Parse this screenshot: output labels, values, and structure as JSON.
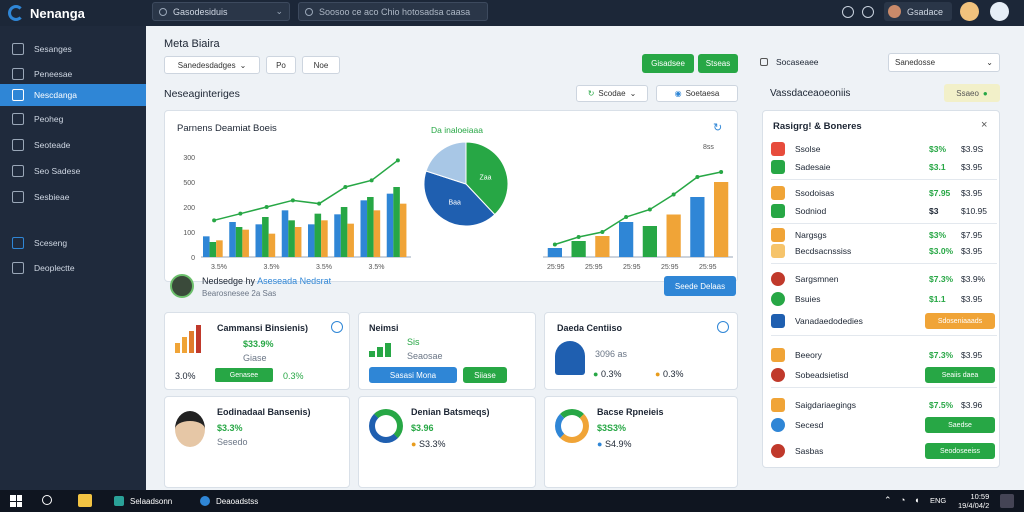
{
  "app": {
    "title": "Nenanga"
  },
  "topbar": {
    "dropdown_label": "Gasodesiduis",
    "search_placeholder": "Soosoo ce aco Chio hotosadsa caasa",
    "user_name": "Gsadace"
  },
  "sidebar": {
    "items": [
      {
        "label": "Sesanges",
        "icon": "grid-icon"
      },
      {
        "label": "Peneesae",
        "icon": "link-icon"
      },
      {
        "label": "Nescdanga",
        "icon": "chart-icon",
        "active": true
      },
      {
        "label": "Peoheg",
        "icon": "pen-icon"
      },
      {
        "label": "Seoteade",
        "icon": "bell-icon"
      },
      {
        "label": "Seo Sadese",
        "icon": "activity-icon"
      },
      {
        "label": "Sesbieae",
        "icon": "cloud-icon"
      },
      {
        "label": "Sceseng",
        "icon": "layers-icon"
      },
      {
        "label": "Deoplectte",
        "icon": "doc-icon"
      }
    ]
  },
  "main": {
    "title": "Meta Biaira",
    "filter_select": "Sanedesdadges",
    "filter_btn1": "Po",
    "filter_btn2": "Noe",
    "action_btn1": "Gisadsee",
    "action_btn2": "Stseas",
    "section_title": "Neseaginteriges",
    "section_select1": "Scodae",
    "section_select2": "Soetaesa",
    "chart": {
      "title": "Parnens Deamiat Boeis",
      "pie_title": "Da inaloeiaaa",
      "pie_labels": [
        "Zaa",
        "Baa"
      ],
      "top_label": "8ss"
    },
    "strip": {
      "title": "Nedsedge hy",
      "highlight": "Aseseada Nedsrat",
      "subtitle": "Bearosnesee 2a Sas",
      "button": "Seede Delaas"
    },
    "cards": [
      {
        "title": "Cammansi Binsienis)",
        "value": "$33.9%",
        "sub": "Giase",
        "f1": "3.0%",
        "f2": "Genasee",
        "f3": "0.3%"
      },
      {
        "title": "Neimsi",
        "value": "Sis",
        "sub": "Seaosae",
        "btn1": "Sasasi Mona",
        "btn2": "Siiase"
      },
      {
        "title": "Daeda Centiiso",
        "sub": "3096 as",
        "f1": "0.3%",
        "f2": "0.3%"
      },
      {
        "title": "Eodinadaal Bansenis)",
        "value": "$3.3%",
        "sub": "Sesedo"
      },
      {
        "title": "Denian Batsmeqs)",
        "value": "$3.96",
        "sub": "S3.3%"
      },
      {
        "title": "Bacse Rpneieis",
        "value": "$3S3%",
        "sub": "S4.9%"
      }
    ]
  },
  "right": {
    "title": "Socaseaee",
    "dropdown": "Sanedosse",
    "section_title": "Vassdaceaoeoniis",
    "badge": "Ssaeo",
    "panel_title": "Rasigrg! & Boneres",
    "rows": [
      {
        "label": "Ssolse",
        "v1": "$3%",
        "v2": "$3.9S"
      },
      {
        "label": "Sadesaie",
        "v1": "$3.1",
        "v2": "$3.95"
      },
      {
        "label": "Ssodoisas",
        "v1": "$7.95",
        "v2": "$3.95"
      },
      {
        "label": "Sodniod",
        "v1": "$3",
        "v2": "$10.95"
      },
      {
        "label": "Nargsgs",
        "v1": "$3%",
        "v2": "$7.95"
      },
      {
        "label": "Becdsacnssiss",
        "v1": "$3.0%",
        "v2": "$3.95"
      },
      {
        "label": "Sargsmnen",
        "v1": "$7.3%",
        "v2": "$3.9%"
      },
      {
        "label": "Bsuies",
        "v1": "$1.1",
        "v2": "$3.95"
      },
      {
        "label": "Vanadaedodedies",
        "btn": "Sdoseniaaads"
      },
      {
        "label": "Beeory",
        "v1": "$7.3%",
        "v2": "$3.95"
      },
      {
        "label": "Sobeadsietisd",
        "btn": "Seaiis daea"
      },
      {
        "label": "Saigdariaegings",
        "v1": "$7.5%",
        "v2": "$3.96"
      },
      {
        "label": "Secesd",
        "btn": "Saedse"
      },
      {
        "label": "Sasbas",
        "btn": "Seodoseeiss"
      }
    ]
  },
  "taskbar": {
    "app1": "Selaadsonn",
    "app2": "Deaoadstss",
    "time": "10:59",
    "date": "19/4/04/2",
    "lang": "ENG"
  },
  "chart_data": [
    {
      "type": "bar",
      "title": "Parnens Deamiat Boeis",
      "categories": [
        "3.5%",
        "3.5%",
        "3.5%",
        "3.5%"
      ],
      "ylim": [
        0,
        3000
      ],
      "yticks": [
        "0",
        "100",
        "200",
        "500",
        "300"
      ],
      "series": [
        {
          "color": "#2f86d6",
          "values": [
            620,
            1050,
            980,
            1400,
            980,
            1280,
            1700,
            1900
          ]
        },
        {
          "color": "#27a745",
          "values": [
            450,
            900,
            1200,
            1100,
            1300,
            1500,
            1800,
            2100
          ]
        },
        {
          "color": "#f0a437",
          "values": [
            500,
            820,
            700,
            900,
            1100,
            1000,
            1400,
            1600
          ]
        }
      ],
      "line": [
        1100,
        1300,
        1500,
        1700,
        1600,
        2100,
        2300,
        2900
      ]
    },
    {
      "type": "pie",
      "title": "Da inaloeiaaa",
      "slices": [
        {
          "label": "Zaa",
          "value": 38,
          "color": "#27a745"
        },
        {
          "label": "Baa",
          "value": 42,
          "color": "#1f5fb0"
        },
        {
          "label": "",
          "value": 20,
          "color": "#a8c7e6"
        }
      ]
    },
    {
      "type": "bar",
      "categories": [
        "25:95",
        "25:95",
        "25:95",
        "25:95",
        "25:95"
      ],
      "values": [
        180,
        320,
        420,
        700,
        620,
        850,
        1200,
        1500
      ],
      "colors": [
        "#2f86d6",
        "#27a745",
        "#f0a437",
        "#2f86d6",
        "#27a745",
        "#f0a437",
        "#2f86d6",
        "#f0a437"
      ],
      "line": [
        250,
        400,
        500,
        800,
        950,
        1250,
        1600,
        1700
      ],
      "ylim": [
        0,
        2000
      ]
    }
  ]
}
